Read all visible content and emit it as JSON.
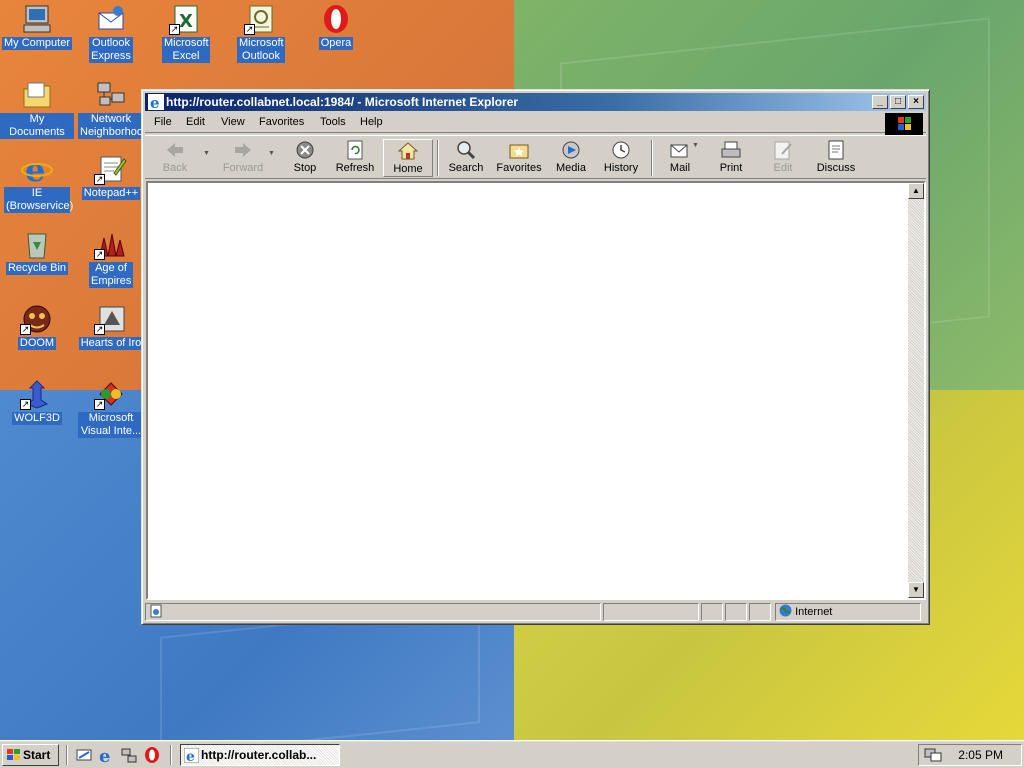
{
  "desktop": {
    "icons": [
      {
        "label": "My Computer",
        "icon": "my-computer-icon"
      },
      {
        "label": "Outlook Express",
        "icon": "outlook-express-icon"
      },
      {
        "label": "Microsoft Excel",
        "icon": "excel-icon"
      },
      {
        "label": "Microsoft Outlook",
        "icon": "outlook-icon"
      },
      {
        "label": "Opera",
        "icon": "opera-icon"
      },
      {
        "label": "My Documents",
        "icon": "my-documents-icon"
      },
      {
        "label": "Network Neighborhood",
        "icon": "network-neighborhood-icon"
      },
      {
        "label": "IE (Browservice)",
        "icon": "internet-explorer-icon"
      },
      {
        "label": "Notepad++",
        "icon": "notepad-plus-plus-icon"
      },
      {
        "label": "Recycle Bin",
        "icon": "recycle-bin-icon"
      },
      {
        "label": "Age of Empires",
        "icon": "age-of-empires-icon"
      },
      {
        "label": "DOOM",
        "icon": "doom-icon"
      },
      {
        "label": "Hearts of Iro",
        "icon": "hearts-of-iron-icon"
      },
      {
        "label": "WOLF3D",
        "icon": "wolf3d-icon"
      },
      {
        "label": "Microsoft Visual Inte...",
        "icon": "visual-interdev-icon"
      }
    ]
  },
  "window": {
    "title": "http://router.collabnet.local:1984/ - Microsoft Internet Explorer",
    "controls": {
      "minimize": "_",
      "maximize": "□",
      "close": "×"
    }
  },
  "menu": [
    {
      "label": "File",
      "key": "F"
    },
    {
      "label": "Edit",
      "key": "E"
    },
    {
      "label": "View",
      "key": "V"
    },
    {
      "label": "Favorites",
      "key": "a"
    },
    {
      "label": "Tools",
      "key": "T"
    },
    {
      "label": "Help",
      "key": "H"
    }
  ],
  "toolbar": {
    "back": "Back",
    "forward": "Forward",
    "stop": "Stop",
    "refresh": "Refresh",
    "home": "Home",
    "search": "Search",
    "favorites": "Favorites",
    "media": "Media",
    "history": "History",
    "mail": "Mail",
    "print": "Print",
    "edit": "Edit",
    "discuss": "Discuss"
  },
  "statusbar": {
    "zone": "Internet"
  },
  "taskbar": {
    "start": "Start",
    "task": "http://router.collab...",
    "clock": "2:05 PM"
  },
  "colors": {
    "titlebar_start": "#0a246a",
    "titlebar_end": "#a6caf0",
    "face": "#d4d0c8",
    "desktop_label_bg": "#2e6ac2"
  }
}
